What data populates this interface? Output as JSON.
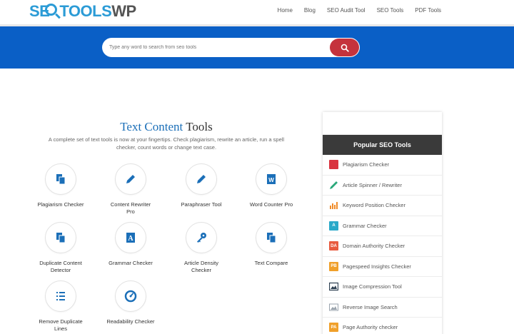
{
  "logo": {
    "part1": "SE",
    "part2": "TOOLS",
    "part3": "WP"
  },
  "nav": [
    "Home",
    "Blog",
    "SEO Audit Tool",
    "SEO Tools",
    "PDF Tools"
  ],
  "search": {
    "placeholder": "Type any word to search from seo tools",
    "value": ""
  },
  "main": {
    "title_accent": "Text Content",
    "title_rest": "Tools",
    "description": "A complete set of text tools is now at your fingertips. Check plagiarism, rewrite an article, run a spell checker, count words or change text case."
  },
  "tools": [
    {
      "label": "Plagiarism Checker",
      "icon": "copy-icon"
    },
    {
      "label": "Content Rewriter Pro",
      "icon": "pencil-icon"
    },
    {
      "label": "Paraphraser Tool",
      "icon": "pencil-icon"
    },
    {
      "label": "Word Counter Pro",
      "icon": "word-doc-icon"
    },
    {
      "label": "Duplicate Content Detector",
      "icon": "copy-icon"
    },
    {
      "label": "Grammar Checker",
      "icon": "grammar-a-icon"
    },
    {
      "label": "Article Density Checker",
      "icon": "key-icon"
    },
    {
      "label": "Text Compare",
      "icon": "copy-icon"
    },
    {
      "label": "Remove Duplicate Lines",
      "icon": "list-icon"
    },
    {
      "label": "Readability Checker",
      "icon": "gauge-icon"
    }
  ],
  "sidebar": {
    "heading": "Popular SEO Tools",
    "items": [
      {
        "label": "Plagiarism Checker",
        "icon": "plagiarism-icon",
        "color": "#d9333f",
        "glyph": ""
      },
      {
        "label": "Article Spinner / Rewriter",
        "icon": "pen-icon",
        "color": "#2aa87a",
        "glyph": ""
      },
      {
        "label": "Keyword Position Checker",
        "icon": "bar-chart-icon",
        "color": "#f08c2a",
        "glyph": ""
      },
      {
        "label": "Grammar Checker",
        "icon": "grammar-icon",
        "color": "#2aa9c9",
        "glyph": "A"
      },
      {
        "label": "Domain Authority Checker",
        "icon": "da-icon",
        "color": "#e85b3f",
        "glyph": "DA"
      },
      {
        "label": "Pagespeed Insights Checker",
        "icon": "pb-icon",
        "color": "#f0a02a",
        "glyph": "PB"
      },
      {
        "label": "Image Compression Tool",
        "icon": "image-compress-icon",
        "color": "#2c3e50",
        "glyph": ""
      },
      {
        "label": "Reverse Image Search",
        "icon": "image-icon",
        "color": "#9aa3ad",
        "glyph": ""
      },
      {
        "label": "Page Authority checker",
        "icon": "pa-icon",
        "color": "#f0a02a",
        "glyph": "PA"
      }
    ]
  },
  "colors": {
    "banner": "#0a5fc6",
    "accent": "#1b6fb8",
    "search_button": "#c5333d",
    "sidebar_head": "#3a3a3a"
  }
}
